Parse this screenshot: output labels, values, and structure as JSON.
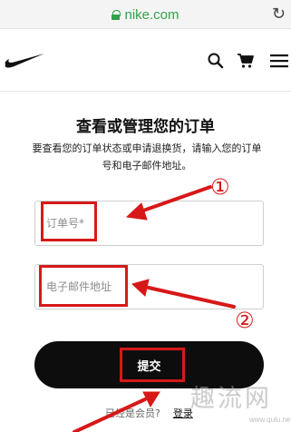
{
  "browser": {
    "url": "nike.com",
    "reload_glyph": "↻"
  },
  "header": {
    "logo": "nike-swoosh-logo",
    "icons": [
      "search-icon",
      "cart-icon",
      "menu-icon"
    ]
  },
  "page": {
    "title": "查看或管理您的订单",
    "description": "要查看您的订单状态或申请退换货，请输入您的订单号和电子邮件地址。"
  },
  "form": {
    "order_placeholder": "订单号*",
    "email_placeholder": "电子邮件地址",
    "submit_label": "提交"
  },
  "footer": {
    "member_text": "已经是会员?",
    "login_label": "登录"
  },
  "annotations": {
    "markers": [
      "①",
      "②"
    ],
    "color": "#d71818"
  },
  "watermark": {
    "text": "趣流网",
    "url": "www.qulu.net"
  }
}
